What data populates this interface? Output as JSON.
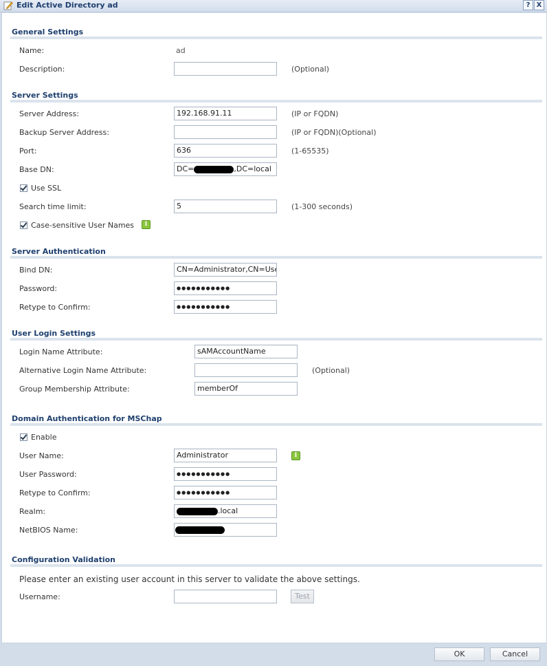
{
  "window": {
    "title": "Edit Active Directory ad",
    "help_btn": "?",
    "close_btn": "X"
  },
  "general": {
    "title": "General Settings",
    "name_label": "Name:",
    "name_value": "ad",
    "desc_label": "Description:",
    "desc_value": "",
    "desc_hint": "(Optional)"
  },
  "server": {
    "title": "Server Settings",
    "address_label": "Server Address:",
    "address_value": "192.168.91.11",
    "address_hint": "(IP or FQDN)",
    "backup_label": "Backup Server Address:",
    "backup_value": "",
    "backup_hint": "(IP or FQDN)(Optional)",
    "port_label": "Port:",
    "port_value": "636",
    "port_hint": "(1-65535)",
    "basedn_label": "Base DN:",
    "basedn_prefix": "DC=",
    "basedn_suffix": ",DC=local",
    "ssl_label": "Use SSL",
    "time_label": "Search time limit:",
    "time_value": "5",
    "time_hint": "(1-300 seconds)",
    "case_label": "Case-sensitive User Names"
  },
  "auth": {
    "title": "Server Authentication",
    "bind_label": "Bind DN:",
    "bind_value": "CN=Administrator,CN=Users",
    "pwd_label": "Password:",
    "pwd_value": "●●●●●●●●●●●",
    "retype_label": "Retype to Confirm:",
    "retype_value": "●●●●●●●●●●●"
  },
  "login": {
    "title": "User Login Settings",
    "attr_label": "Login Name Attribute:",
    "attr_value": "sAMAccountName",
    "alt_label": "Alternative Login Name Attribute:",
    "alt_value": "",
    "alt_hint": "(Optional)",
    "group_label": "Group Membership Attribute:",
    "group_value": "memberOf"
  },
  "domain": {
    "title": "Domain Authentication for MSChap",
    "enable_label": "Enable",
    "user_label": "User Name:",
    "user_value": "Administrator",
    "pwd_label": "User Password:",
    "pwd_value": "●●●●●●●●●●●",
    "retype_label": "Retype to Confirm:",
    "retype_value": "●●●●●●●●●●●",
    "realm_label": "Realm:",
    "realm_suffix": ".local",
    "netbios_label": "NetBIOS Name:"
  },
  "validation": {
    "title": "Configuration Validation",
    "note": "Please enter an existing user account in this server to validate the above settings.",
    "user_label": "Username:",
    "user_value": "",
    "test_label": "Test"
  },
  "footer": {
    "ok": "OK",
    "cancel": "Cancel"
  },
  "colors": {
    "section_title": "#1e3f6e",
    "info_icon": "#8cc63f",
    "background": "#d3dde9"
  }
}
